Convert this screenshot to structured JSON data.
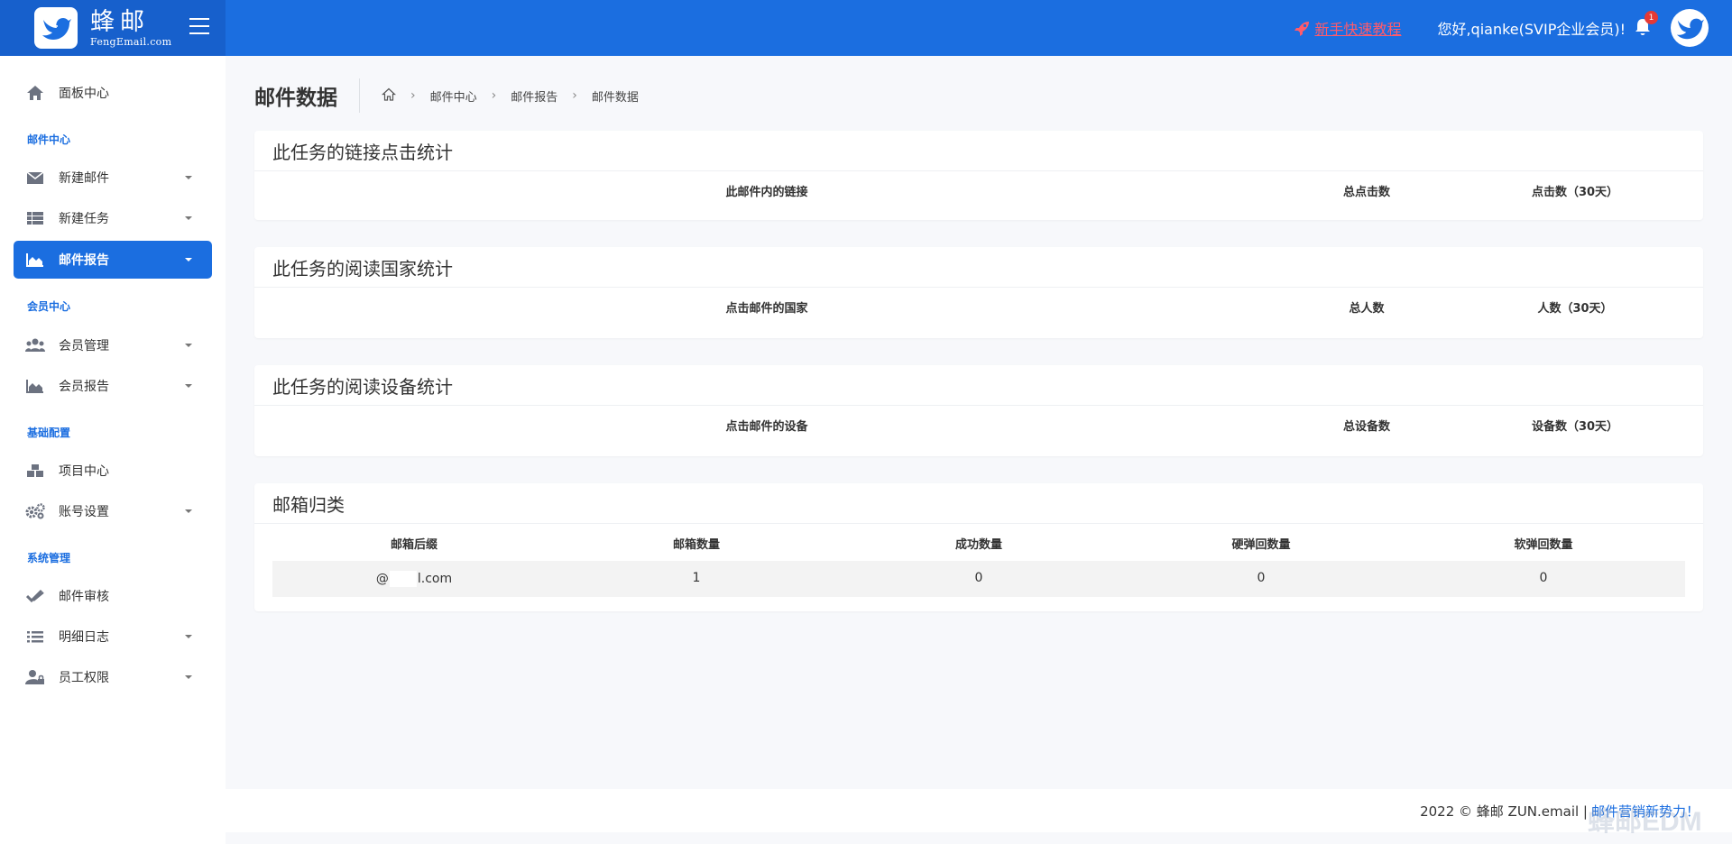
{
  "header": {
    "brand_cn": "蜂邮",
    "brand_en": "FengEmail.com",
    "tutorial_link": "新手快速教程",
    "greeting": "您好,qianke(SVIP企业会员)!",
    "notification_count": "1"
  },
  "sidebar": {
    "dashboard": "面板中心",
    "section_mail": "邮件中心",
    "new_mail": "新建邮件",
    "new_task": "新建任务",
    "mail_report": "邮件报告",
    "section_member": "会员中心",
    "member_manage": "会员管理",
    "member_report": "会员报告",
    "section_basic": "基础配置",
    "project_center": "项目中心",
    "account_settings": "账号设置",
    "section_system": "系统管理",
    "mail_review": "邮件审核",
    "detail_log": "明细日志",
    "staff_permission": "员工权限"
  },
  "page": {
    "title": "邮件数据",
    "breadcrumb": [
      "邮件中心",
      "邮件报告",
      "邮件数据"
    ]
  },
  "link_stats": {
    "title": "此任务的链接点击统计",
    "columns": [
      "此邮件内的链接",
      "总点击数",
      "点击数（30天）"
    ]
  },
  "country_stats": {
    "title": "此任务的阅读国家统计",
    "columns": [
      "点击邮件的国家",
      "总人数",
      "人数（30天）"
    ]
  },
  "device_stats": {
    "title": "此任务的阅读设备统计",
    "columns": [
      "点击邮件的设备",
      "总设备数",
      "设备数（30天）"
    ]
  },
  "mailbox_class": {
    "title": "邮箱归类",
    "columns": [
      "邮箱后缀",
      "邮箱数量",
      "成功数量",
      "硬弹回数量",
      "软弹回数量"
    ],
    "row": {
      "suffix_prefix": "@",
      "suffix_rest": "l.com",
      "count": "1",
      "success": "0",
      "hard_bounce": "0",
      "soft_bounce": "0"
    }
  },
  "footer": {
    "copyright": "2022 © 蜂邮 ZUN.email |",
    "slogan": "邮件营销新势力！",
    "watermark": "蜂邮EDM"
  },
  "colors": {
    "primary": "#1b6ee0",
    "tutorial": "#ff5b6b"
  }
}
